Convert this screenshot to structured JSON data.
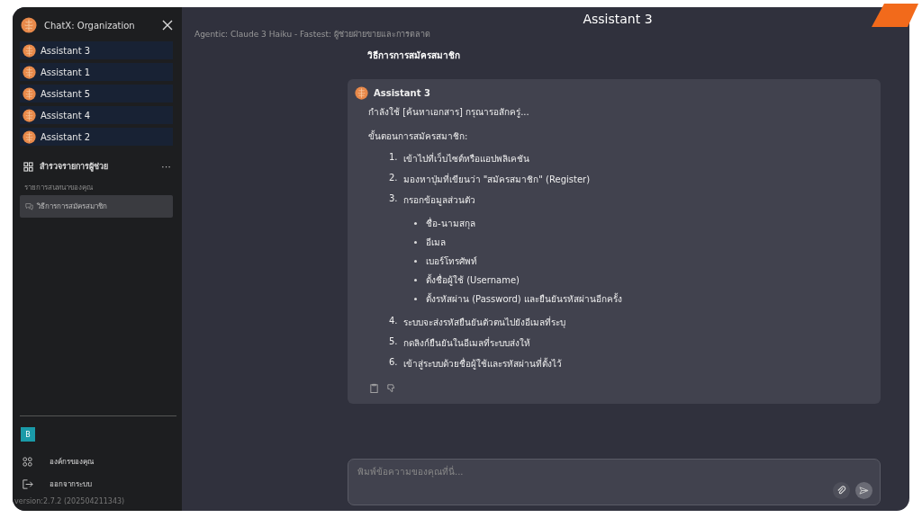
{
  "sidebar": {
    "title": "ChatX: Organization",
    "assistants": [
      {
        "name": "Assistant 3"
      },
      {
        "name": "Assistant 1"
      },
      {
        "name": "Assistant 5"
      },
      {
        "name": "Assistant 4"
      },
      {
        "name": "Assistant 2"
      }
    ],
    "explore": {
      "label": "สำรวจรายการผู้ช่วย",
      "more": "···"
    },
    "history_heading": "รายการสนทนาของคุณ",
    "chats": [
      {
        "title": "วิธีการการสมัครสมาชิก",
        "selected": true
      }
    ],
    "user_badge": "B",
    "menu": [
      {
        "kind": "org",
        "label": "องค์กรของคุณ"
      },
      {
        "kind": "logout",
        "label": "ออกจากระบบ"
      }
    ],
    "version": "version:2.7.2 (202504211343)"
  },
  "header": {
    "title": "Assistant 3",
    "subtitle": "Agentic: Claude 3 Haiku - Fastest: ผู้ช่วยฝ่ายขายและการตลาด"
  },
  "messages": [
    {
      "kind": "user",
      "text": "วิธีการการสมัครสมาชิก"
    },
    {
      "kind": "assistant",
      "author": "Assistant 3",
      "status": "กำลังใช้ [ค้นหาเอกสาร] กรุณารอสักครู่...",
      "heading": "ขั้นตอนการสมัครสมาชิก:",
      "steps": [
        {
          "number": "1.",
          "text": "เข้าไปที่เว็บไซต์หรือแอปพลิเคชัน"
        },
        {
          "number": "2.",
          "text": "มองหาปุ่มที่เขียนว่า \"สมัครสมาชิก\" (Register)"
        },
        {
          "number": "3.",
          "text": "กรอกข้อมูลส่วนตัว",
          "children": [
            "ชื่อ-นามสกุล",
            "อีเมล",
            "เบอร์โทรศัพท์",
            "ตั้งชื่อผู้ใช้ (Username)",
            "ตั้งรหัสผ่าน (Password) และยืนยันรหัสผ่านอีกครั้ง"
          ]
        },
        {
          "number": "4.",
          "text": "ระบบจะส่งรหัสยืนยันตัวตนไปยังอีเมลที่ระบุ"
        },
        {
          "number": "5.",
          "text": "กดลิงก์ยืนยันในอีเมลที่ระบบส่งให้"
        },
        {
          "number": "6.",
          "text": "เข้าสู่ระบบด้วยชื่อผู้ใช้และรหัสผ่านที่ตั้งไว้"
        }
      ]
    }
  ],
  "composer": {
    "placeholder": "พิมพ์ข้อความของคุณที่นี่..."
  }
}
